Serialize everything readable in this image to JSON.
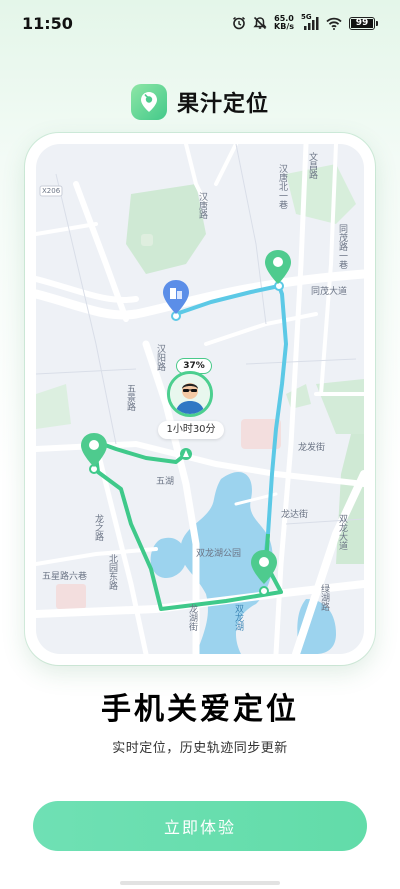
{
  "status_bar": {
    "time": "11:50",
    "network_speed_value": "65.0",
    "network_speed_unit": "KB/s",
    "signal_label": "5G",
    "battery": "99",
    "battery_level": 0.99,
    "icons": [
      "alarm-icon",
      "mute-icon",
      "signal-icon",
      "wifi-icon",
      "battery-icon"
    ]
  },
  "header": {
    "app_name": "果汁定位",
    "logo_icon": "location-pin-logo"
  },
  "map": {
    "labels": {
      "x206": "X206",
      "wenchang_road": "文昌路",
      "hantang_road": "汉唐路",
      "hantang_north_1st": "汉唐北一巷",
      "tongmao_ave": "同茂大道",
      "tongmao_road_1": "同茂路一巷",
      "hanyang_road": "汉阳路",
      "wujing_road": "五景路",
      "wujing_6th": "五星路六巷",
      "longfa_st": "龙发街",
      "longda_st": "龙达街",
      "shuanglong_lake_park": "双龙湖公园",
      "shuanglong_lake": "双龙湖",
      "beiyuan_road": "北园东路",
      "longhu_road": "龙湖街",
      "shuanglong_ave": "双龙大道",
      "longzhi_road": "龙之路",
      "luhu_road": "绿湖路",
      "wuhu": "五湖"
    },
    "battery_percent": "37%",
    "duration": "1小时30分",
    "route_colors": {
      "blue": "#5cc9e6",
      "green": "#3fc98a"
    }
  },
  "headline": "手机关爱定位",
  "subtitle": "实时定位，历史轨迹同步更新",
  "cta": "立即体验"
}
